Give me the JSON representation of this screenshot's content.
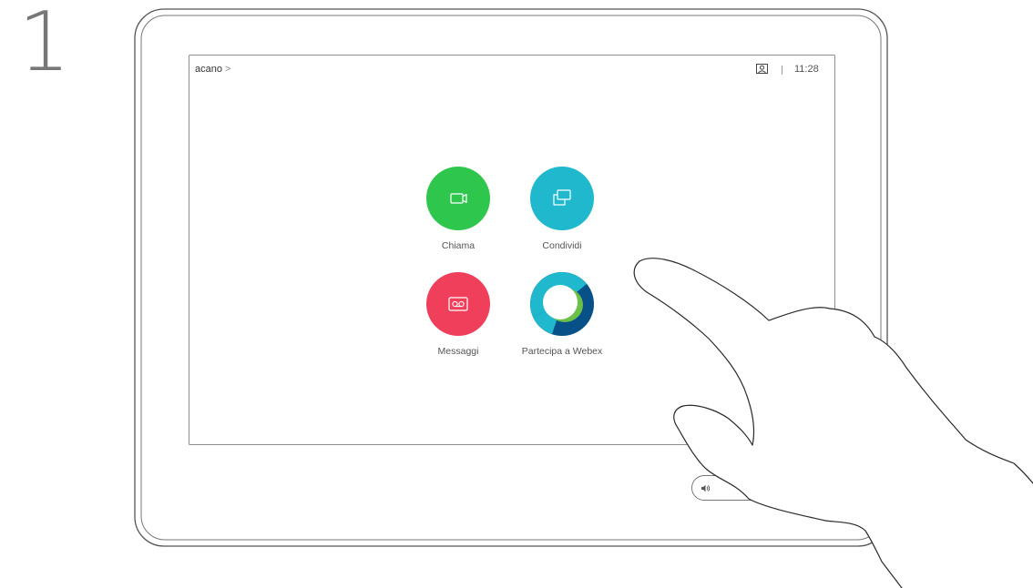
{
  "step": {
    "number": "1"
  },
  "status_bar": {
    "device_name": "acano",
    "chevron": ">",
    "selfview_icon": "selfview-icon",
    "time": "11:28"
  },
  "actions": [
    {
      "label": "Chiama",
      "icon": "video-camera-icon",
      "color": "#2fc64e"
    },
    {
      "label": "Condividi",
      "icon": "share-screen-icon",
      "color": "#1fb8cc"
    },
    {
      "label": "Messaggi",
      "icon": "voicemail-icon",
      "color": "#ef3f5b"
    },
    {
      "label": "Partecipa a Webex",
      "icon": "webex-icon",
      "colors": [
        "#1fb8cc",
        "#6cc04a",
        "#075088"
      ]
    }
  ],
  "volume": {
    "icon": "speaker-icon"
  }
}
